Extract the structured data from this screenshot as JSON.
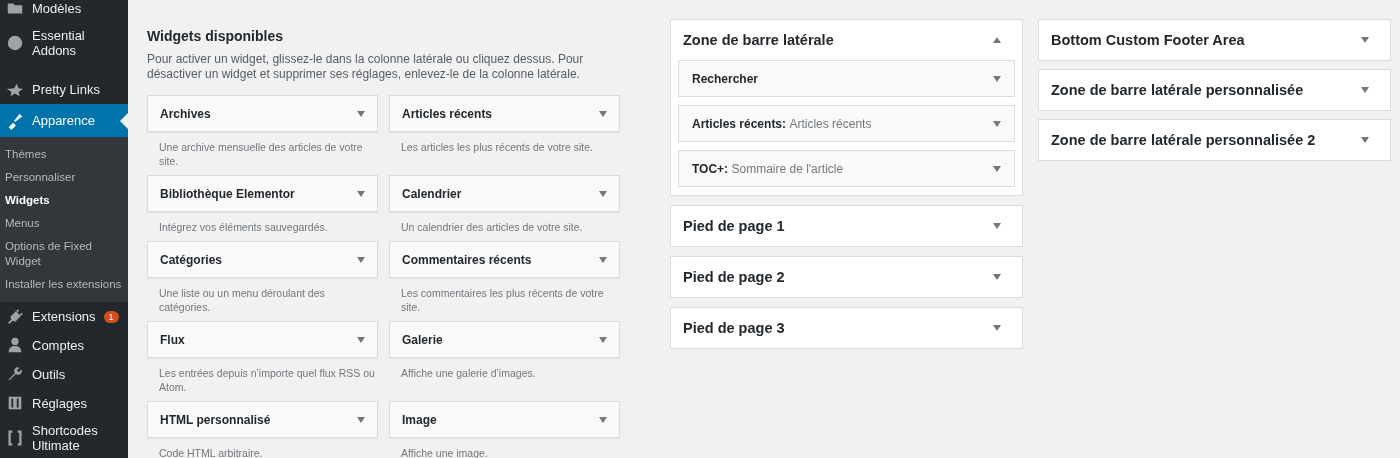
{
  "admin_menu": {
    "items": [
      {
        "label": "Modèles",
        "selected": false
      },
      {
        "label": "Essential Addons",
        "selected": false
      },
      {
        "label": "Pretty Links",
        "selected": false
      },
      {
        "label": "Apparence",
        "selected": true,
        "children": [
          {
            "label": "Thèmes",
            "selected": false
          },
          {
            "label": "Personnaliser",
            "selected": false
          },
          {
            "label": "Widgets",
            "selected": true
          },
          {
            "label": "Menus",
            "selected": false
          },
          {
            "label": "Options de Fixed Widget",
            "selected": false
          },
          {
            "label": "Installer les extensions",
            "selected": false
          }
        ]
      },
      {
        "label": "Extensions",
        "selected": false,
        "badge": "1"
      },
      {
        "label": "Comptes",
        "selected": false
      },
      {
        "label": "Outils",
        "selected": false
      },
      {
        "label": "Réglages",
        "selected": false
      },
      {
        "label": "Shortcodes Ultimate",
        "selected": false
      }
    ]
  },
  "available_widgets": {
    "title": "Widgets disponibles",
    "description": "Pour activer un widget, glissez-le dans la colonne latérale ou cliquez dessus. Pour désactiver un widget et supprimer ses réglages, enlevez-le de la colonne latérale.",
    "widgets": [
      {
        "title": "Archives",
        "description": "Une archive mensuelle des articles de votre site."
      },
      {
        "title": "Articles récents",
        "description": "Les articles les plus récents de votre site."
      },
      {
        "title": "Bibliothèque Elementor",
        "description": "Intégrez vos éléments sauvegardés."
      },
      {
        "title": "Calendrier",
        "description": "Un calendrier des articles de votre site."
      },
      {
        "title": "Catégories",
        "description": "Une liste ou un menu déroulant des catégories."
      },
      {
        "title": "Commentaires récents",
        "description": "Les commentaires les plus récents de votre site."
      },
      {
        "title": "Flux",
        "description": "Les entrées depuis n’importe quel flux RSS ou Atom."
      },
      {
        "title": "Galerie",
        "description": "Affiche une galerie d’images."
      },
      {
        "title": "HTML personnalisé",
        "description": "Code HTML arbitraire."
      },
      {
        "title": "Image",
        "description": "Affiche une image."
      }
    ]
  },
  "widget_areas": [
    [
      {
        "title": "Zone de barre latérale",
        "expanded": true,
        "widgets": [
          {
            "title": "Rechercher"
          },
          {
            "title": "Articles récents:",
            "subtitle": "Articles récents"
          },
          {
            "title": "TOC+:",
            "subtitle": "Sommaire de l'article"
          }
        ]
      },
      {
        "title": "Pied de page 1",
        "expanded": false
      },
      {
        "title": "Pied de page 2",
        "expanded": false
      },
      {
        "title": "Pied de page 3",
        "expanded": false
      }
    ],
    [
      {
        "title": "Bottom Custom Footer Area",
        "expanded": false
      },
      {
        "title": "Zone de barre latérale personnalisée",
        "expanded": false
      },
      {
        "title": "Zone de barre latérale personnalisée 2",
        "expanded": false
      }
    ]
  ]
}
